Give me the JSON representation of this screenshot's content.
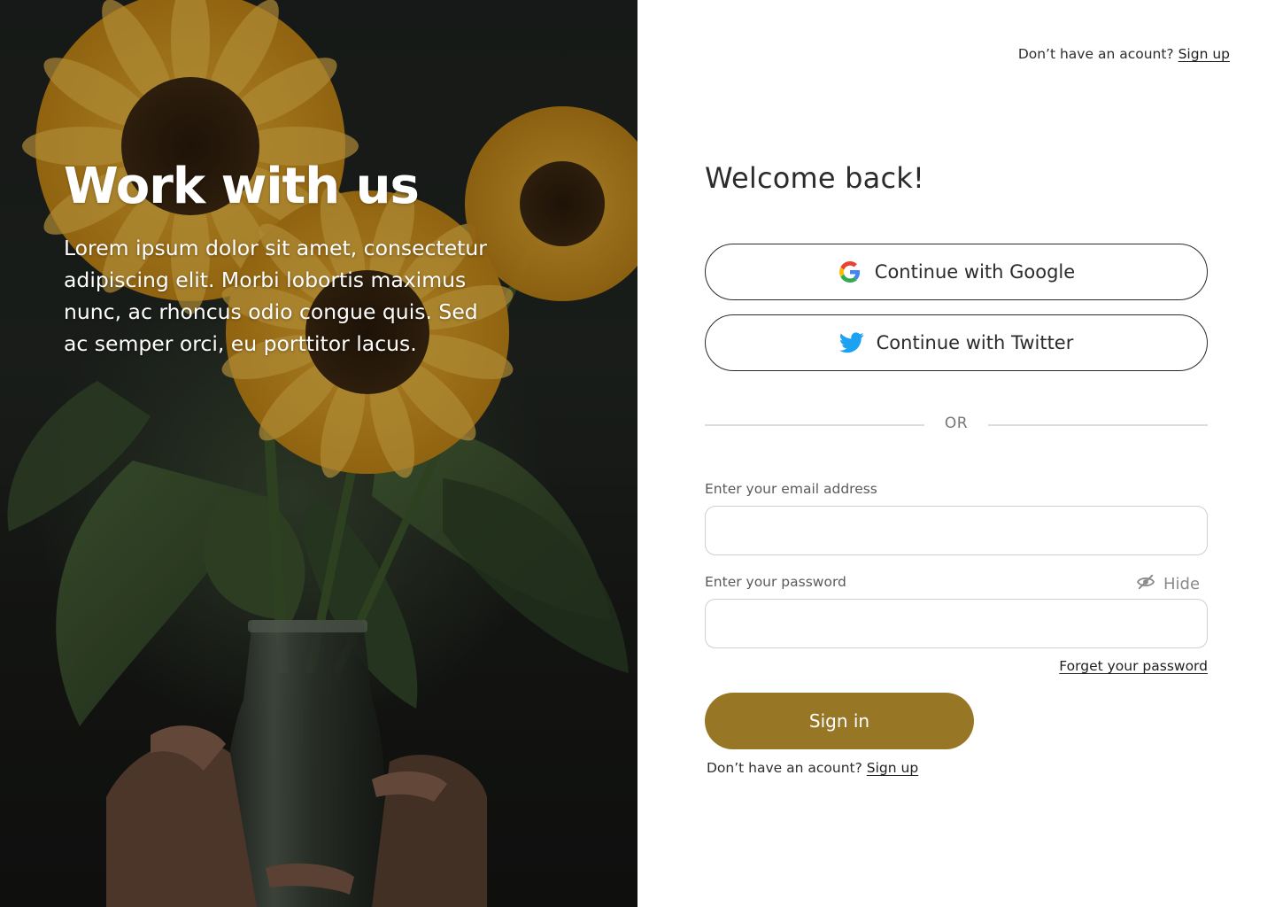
{
  "hero": {
    "title": "Work with us",
    "text": "Lorem ipsum dolor sit amet, consectetur adipiscing elit. Morbi lobortis maximus nunc, ac rhoncus odio congue quis. Sed ac semper orci, eu porttitor lacus."
  },
  "header": {
    "prompt": "Don’t have an acount?",
    "signup_link": "Sign up"
  },
  "form": {
    "welcome": "Welcome back!",
    "google_label": "Continue with Google",
    "twitter_label": "Continue with Twitter",
    "or_label": "OR",
    "email_label": "Enter your email address",
    "email_value": "",
    "password_label": "Enter your password",
    "password_value": "",
    "hide_label": "Hide",
    "forgot_link": "Forget your password",
    "signin_label": "Sign in",
    "footer_prompt": "Don’t have an acount?",
    "footer_signup_link": "Sign up"
  },
  "icons": {
    "google": "google-logo-icon",
    "twitter": "twitter-bird-icon",
    "hide": "eye-slash-icon"
  },
  "colors": {
    "accent": "#977726",
    "twitter_blue": "#1da1f2",
    "text": "#2b2b2b",
    "border": "#cfcfcf"
  }
}
